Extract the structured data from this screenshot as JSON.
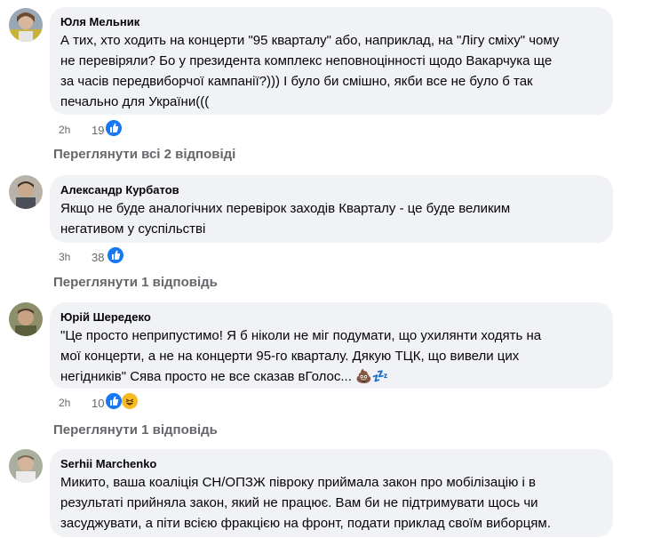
{
  "comments": [
    {
      "author": "Юля Мельник",
      "lines": [
        "А тих, хто ходить на концерти \"95 кварталу\" або, наприклад, на \"Лігу сміху\" чому",
        "не перевіряли? Бо у президента комплекс неповноцінності щодо Вакарчука ще",
        "за часів передвиборчої кампанії?))) І було би смішно, якби все не було б так",
        "печально для України((("
      ],
      "time": "2h",
      "reactions": "19",
      "replies_label": "Переглянути всі 2 відповіді"
    },
    {
      "author": "Александр Курбатов",
      "lines": [
        "Якщо не буде аналогічних перевірок заходів Кварталу - це буде великим",
        "негативом у суспільстві"
      ],
      "time": "3h",
      "reactions": "38",
      "replies_label": "Переглянути 1 відповідь"
    },
    {
      "author": "Юрій Шередеко",
      "lines": [
        "\"Це просто неприпустимо! Я б ніколи не міг подумати, що ухилянти ходять на",
        "мої концерти, а не на концерти 95-го кварталу. Дякую ТЦК, що вивели цих",
        "негідників\" Сява просто не все сказав вГолос... 💩💤"
      ],
      "time": "2h",
      "reactions": "10",
      "replies_label": "Переглянути 1 відповідь"
    },
    {
      "author": "Serhii Marchenko",
      "lines": [
        "Микито, ваша коаліція СН/ОПЗЖ півроку приймала закон про мобілізацію і в",
        "результаті прийняла закон, який не працює. Вам би не підтримувати щось чи",
        "засуджувати, а піти всією фракцією на фронт, подати приклад своїм виборцям."
      ]
    }
  ],
  "colors": {
    "like": "#1877f2",
    "laugh": "#f7b928",
    "bubble": "#f0f2f5",
    "meta": "#65676b"
  }
}
